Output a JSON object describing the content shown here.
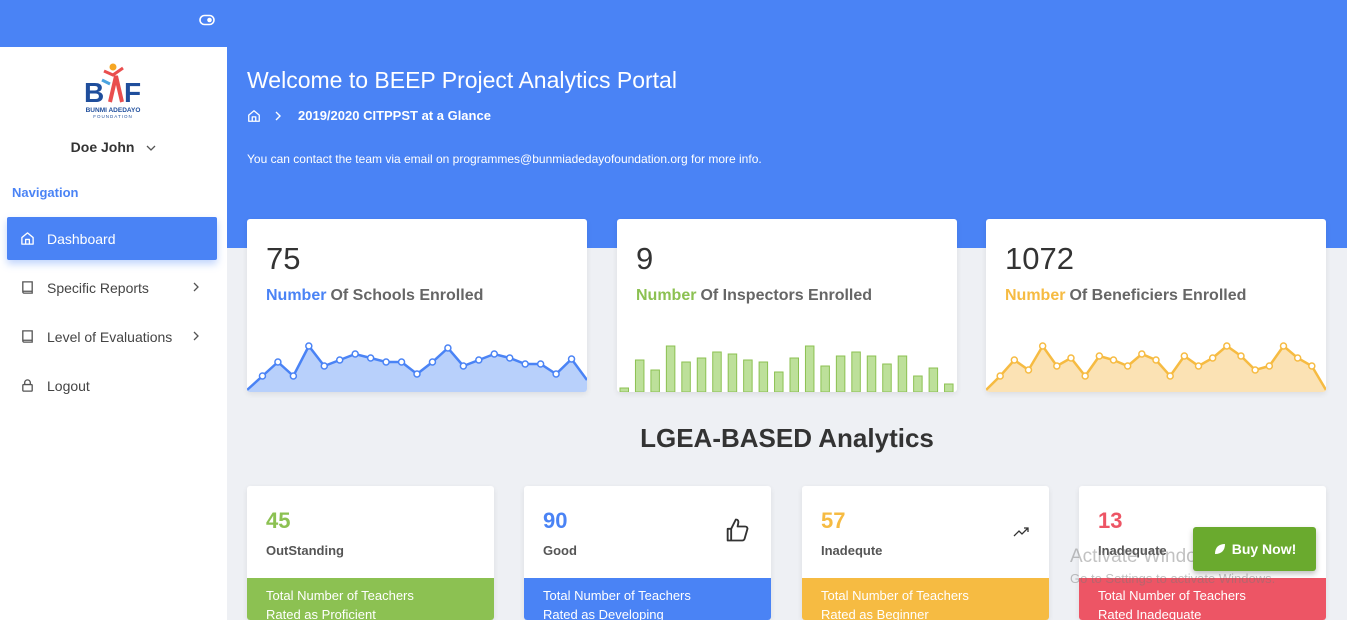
{
  "app": {
    "title": "Welcome to BEEP Project Analytics Portal",
    "breadcrumb_current": "2019/2020 CITPPST at a Glance",
    "contact_text": "You can contact the team via email on programmes@bunmiadedayofoundation.org for more info."
  },
  "logo": {
    "letters": "BAF",
    "line1": "BUNMI ADEDAYO",
    "line2": "FOUNDATION"
  },
  "user": {
    "name": "Doe John"
  },
  "sidebar": {
    "heading": "Navigation",
    "items": [
      {
        "label": "Dashboard",
        "icon": "home-icon",
        "active": true
      },
      {
        "label": "Specific Reports",
        "icon": "book-icon",
        "has_submenu": true
      },
      {
        "label": "Level of Evaluations",
        "icon": "book-icon",
        "has_submenu": true
      },
      {
        "label": "Logout",
        "icon": "lock-icon"
      }
    ]
  },
  "stats": [
    {
      "value": "75",
      "highlight": "Number",
      "caption": "Of Schools Enrolled",
      "color": "#4a83f5",
      "chart": "area"
    },
    {
      "value": "9",
      "highlight": "Number",
      "caption": "Of Inspectors Enrolled",
      "color": "#8cc152",
      "chart": "bar"
    },
    {
      "value": "1072",
      "highlight": "Number",
      "caption": "Of Beneficiers Enrolled",
      "color": "#f6bb42",
      "chart": "area"
    }
  ],
  "section": {
    "title": "LGEA-BASED Analytics"
  },
  "lgea": [
    {
      "value": "45",
      "label": "OutStanding",
      "color": "#8cc152",
      "foot1": "Total Number of Teachers",
      "foot2": "Rated as Proficient",
      "icon": "trend-icon"
    },
    {
      "value": "90",
      "label": "Good",
      "color": "#4a83f5",
      "foot1": "Total Number of Teachers",
      "foot2": "Rated as Developing",
      "icon": "thumbs-up-icon"
    },
    {
      "value": "57",
      "label": "Inadequte",
      "color": "#f6bb42",
      "foot1": "Total Number of Teachers",
      "foot2": "Rated as Beginner",
      "icon": "trend-icon"
    },
    {
      "value": "13",
      "label": "Inadequate",
      "color": "#ed5565",
      "foot1": "Total Number of Teachers",
      "foot2": "Rated Inadequate",
      "icon": "trend-icon"
    }
  ],
  "watermark": {
    "line1": "Activate Windows",
    "line2": "Go to Settings to activate Windows."
  },
  "buy_button": {
    "label": "Buy Now!"
  }
}
